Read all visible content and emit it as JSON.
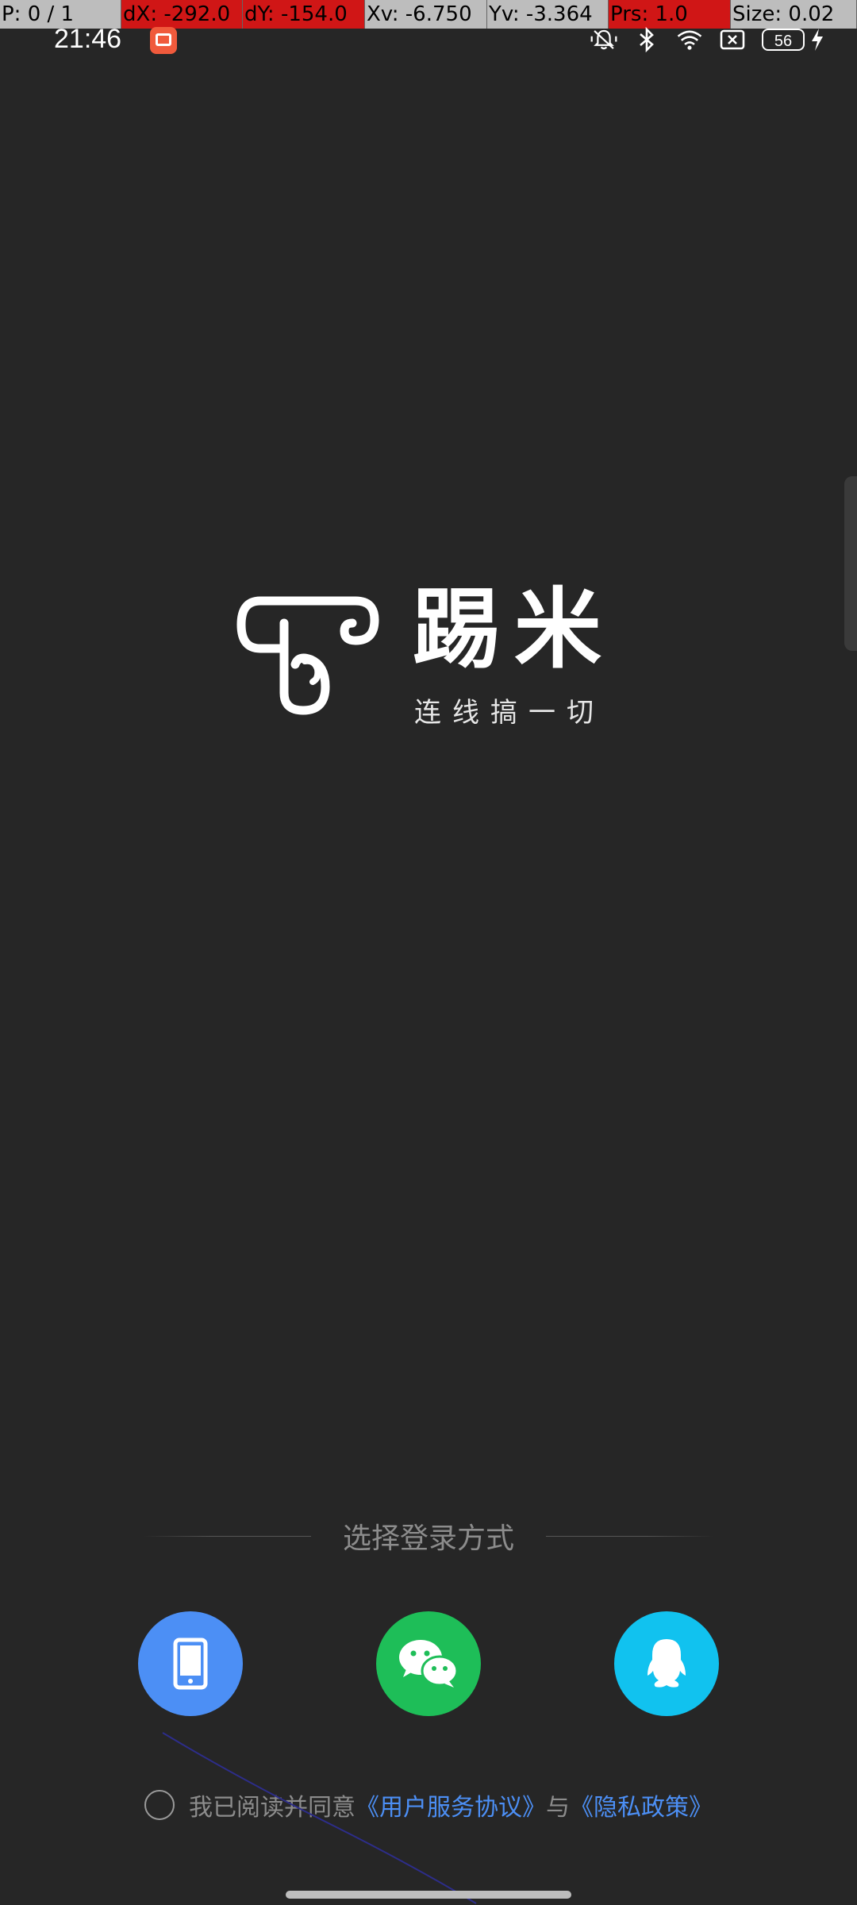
{
  "debug_bar": {
    "p": "P: 0 / 1",
    "dx": "dX: -292.0",
    "dy": "dY: -154.0",
    "xv": "Xv: -6.750",
    "yv": "Yv: -3.364",
    "prs": "Prs: 1.0",
    "size": "Size: 0.02"
  },
  "status_bar": {
    "time": "21:46",
    "battery": "56",
    "icons": [
      "app-notification-icon",
      "mute-bell-icon",
      "bluetooth-icon",
      "wifi-icon",
      "sim-off-icon",
      "battery-icon",
      "charging-bolt-icon"
    ]
  },
  "logo": {
    "name": "踢米",
    "slogan": "连线搞一切"
  },
  "login": {
    "divider_text": "选择登录方式",
    "methods": [
      {
        "name": "phone",
        "icon": "phone-icon",
        "color": "#4c8ff5"
      },
      {
        "name": "wechat",
        "icon": "wechat-icon",
        "color": "#1ebe58"
      },
      {
        "name": "qq",
        "icon": "qq-penguin-icon",
        "color": "#11c2ef"
      }
    ]
  },
  "agreement": {
    "prefix": "我已阅读并同意",
    "user_agreement": "《用户服务协议》",
    "conjunction": "与",
    "privacy_policy": "《隐私政策》"
  },
  "colors": {
    "background": "#262626",
    "link": "#4c8ff5"
  }
}
